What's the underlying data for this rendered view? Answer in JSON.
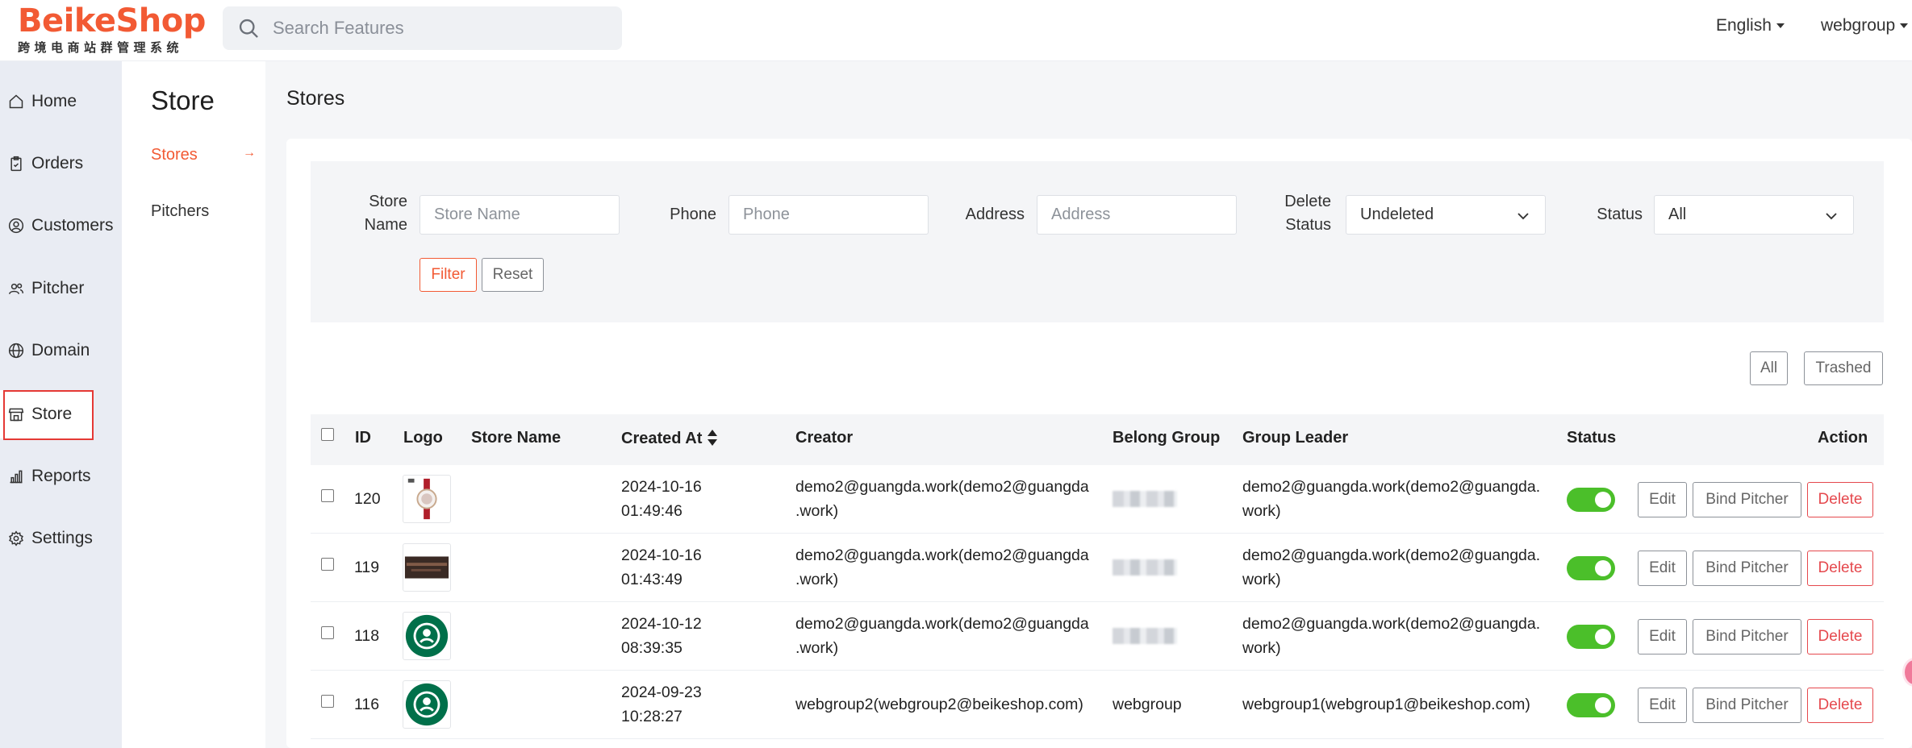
{
  "header": {
    "logo_text": "BeikeShop",
    "logo_subtitle": "跨境电商站群管理系统",
    "search_placeholder": "Search Features",
    "language": "English",
    "user": "webgroup"
  },
  "leftnav": {
    "items": [
      {
        "label": "Home",
        "icon": "home-icon"
      },
      {
        "label": "Orders",
        "icon": "clipboard-icon"
      },
      {
        "label": "Customers",
        "icon": "user-circle-icon"
      },
      {
        "label": "Pitcher",
        "icon": "users-icon"
      },
      {
        "label": "Domain",
        "icon": "globe-icon"
      },
      {
        "label": "Store",
        "icon": "store-icon"
      },
      {
        "label": "Reports",
        "icon": "bar-chart-icon"
      },
      {
        "label": "Settings",
        "icon": "gear-icon"
      }
    ],
    "active": "Store"
  },
  "subnav": {
    "title": "Store",
    "items": [
      {
        "label": "Stores",
        "arrow": "→"
      },
      {
        "label": "Pitchers"
      }
    ]
  },
  "page": {
    "title": "Stores"
  },
  "filter": {
    "store_name_label": "Store Name",
    "store_name_placeholder": "Store Name",
    "phone_label": "Phone",
    "phone_placeholder": "Phone",
    "address_label": "Address",
    "address_placeholder": "Address",
    "delete_status_label": "Delete Status",
    "delete_status_value": "Undeleted",
    "status_label": "Status",
    "status_value": "All",
    "filter_button": "Filter",
    "reset_button": "Reset"
  },
  "view_tabs": {
    "all": "All",
    "trashed": "Trashed"
  },
  "table": {
    "columns": {
      "id": "ID",
      "logo": "Logo",
      "store_name": "Store Name",
      "created_at": "Created At",
      "creator": "Creator",
      "belong_group": "Belong Group",
      "group_leader": "Group Leader",
      "status": "Status",
      "action": "Action"
    },
    "action_labels": {
      "edit": "Edit",
      "bind": "Bind Pitcher",
      "delete": "Delete"
    },
    "rows": [
      {
        "id": "120",
        "logo": "watch",
        "store_name": "",
        "created_date": "2024-10-16",
        "created_time": "01:49:46",
        "creator_line1": "demo2@guangda.work(demo2@guangda",
        "creator_line2": ".work)",
        "belong_group": "",
        "leader_line1": "demo2@guangda.work(demo2@guangda.",
        "leader_line2": "work)",
        "status": true
      },
      {
        "id": "119",
        "logo": "banner",
        "store_name": "",
        "created_date": "2024-10-16",
        "created_time": "01:43:49",
        "creator_line1": "demo2@guangda.work(demo2@guangda",
        "creator_line2": ".work)",
        "belong_group": "",
        "leader_line1": "demo2@guangda.work(demo2@guangda.",
        "leader_line2": "work)",
        "status": true
      },
      {
        "id": "118",
        "logo": "starbucks",
        "store_name": "",
        "created_date": "2024-10-12",
        "created_time": "08:39:35",
        "creator_line1": "demo2@guangda.work(demo2@guangda",
        "creator_line2": ".work)",
        "belong_group": "",
        "leader_line1": "demo2@guangda.work(demo2@guangda.",
        "leader_line2": "work)",
        "status": true
      },
      {
        "id": "116",
        "logo": "starbucks",
        "store_name": "",
        "created_date": "2024-09-23",
        "created_time": "10:28:27",
        "creator_line1": "webgroup2(webgroup2@beikeshop.com)",
        "creator_line2": "",
        "belong_group": "webgroup",
        "leader_line1": "webgroup1(webgroup1@beikeshop.com)",
        "leader_line2": "",
        "status": true
      }
    ]
  },
  "colors": {
    "brand": "#f25a34",
    "success": "#4bbf2a",
    "danger": "#e5484d"
  }
}
